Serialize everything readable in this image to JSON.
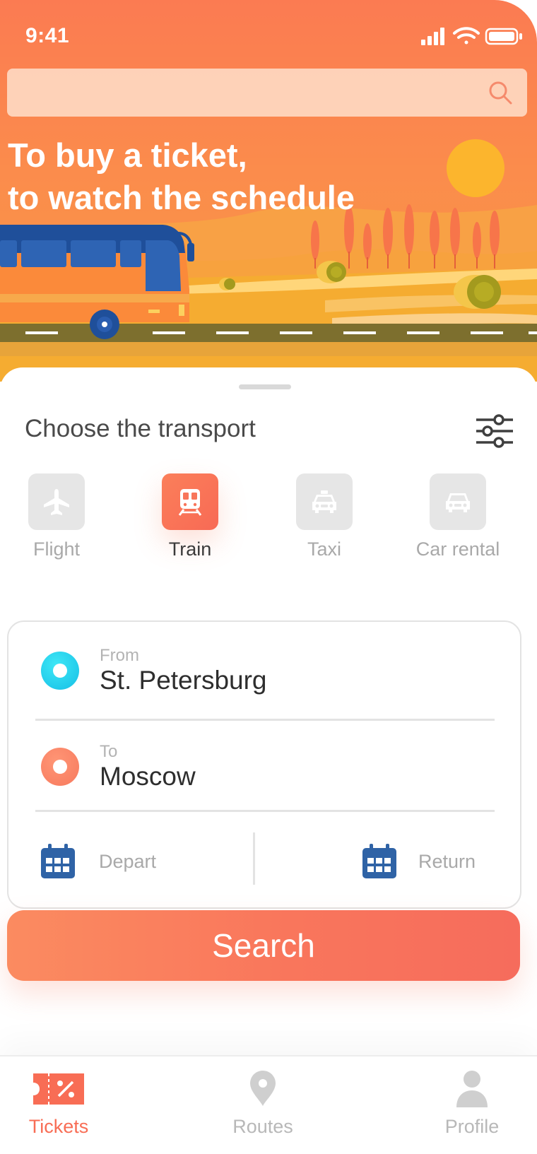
{
  "status_bar": {
    "time": "9:41"
  },
  "search": {
    "placeholder": "",
    "icon": "search-icon"
  },
  "hero": {
    "line1": "To buy a ticket,",
    "line2": "to watch the schedule"
  },
  "transport": {
    "title": "Choose the transport",
    "filter_icon": "sliders-icon",
    "items": [
      {
        "label": "Flight",
        "icon": "airplane-icon",
        "active": false
      },
      {
        "label": "Train",
        "icon": "train-icon",
        "active": true
      },
      {
        "label": "Taxi",
        "icon": "taxi-icon",
        "active": false
      },
      {
        "label": "Car rental",
        "icon": "car-icon",
        "active": false
      }
    ]
  },
  "route": {
    "from_label": "From",
    "from_value": "St. Petersburg",
    "to_label": "To",
    "to_value": "Moscow",
    "depart_label": "Depart",
    "return_label": "Return"
  },
  "search_button": {
    "label": "Search"
  },
  "tabs": [
    {
      "label": "Tickets",
      "icon": "ticket-icon",
      "active": true
    },
    {
      "label": "Routes",
      "icon": "map-pin-icon",
      "active": false
    },
    {
      "label": "Profile",
      "icon": "user-icon",
      "active": false
    }
  ],
  "colors": {
    "accent": "#f86d55",
    "hero_top": "#fb7b52",
    "from_dot": "#16bfe6",
    "to_dot": "#f77a5e",
    "calendar": "#2f63a6",
    "inactive": "#a9a9a9"
  }
}
